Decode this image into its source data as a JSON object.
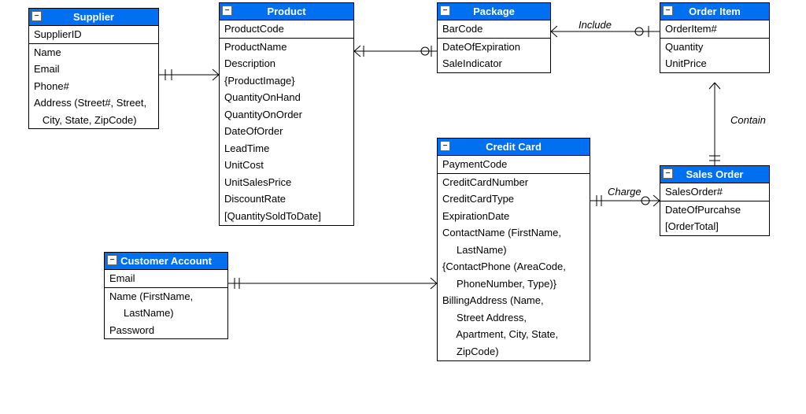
{
  "entities": {
    "supplier": {
      "title": "Supplier",
      "pk": [
        "SupplierID"
      ],
      "attrs": [
        "Name",
        "Email",
        "Phone#",
        "Address (Street#, Street,",
        "   City, State, ZipCode)"
      ]
    },
    "product": {
      "title": "Product",
      "pk": [
        "ProductCode"
      ],
      "attrs": [
        "ProductName",
        "Description",
        "{ProductImage}",
        "QuantityOnHand",
        "QuantityOnOrder",
        "DateOfOrder",
        "LeadTime",
        "UnitCost",
        "UnitSalesPrice",
        "DiscountRate",
        "[QuantitySoldToDate]"
      ]
    },
    "package": {
      "title": "Package",
      "pk": [
        "BarCode"
      ],
      "attrs": [
        "DateOfExpiration",
        "SaleIndicator"
      ]
    },
    "orderitem": {
      "title": "Order Item",
      "pk": [
        "OrderItem#"
      ],
      "attrs": [
        "Quantity",
        "UnitPrice"
      ]
    },
    "creditcard": {
      "title": "Credit Card",
      "pk": [
        "PaymentCode"
      ],
      "attrs": [
        "CreditCardNumber",
        "CreditCardType",
        "ExpirationDate",
        "ContactName (FirstName,",
        "     LastName)",
        "{ContactPhone (AreaCode,",
        "     PhoneNumber, Type)}",
        "BillingAddress (Name,",
        "     Street Address,",
        "     Apartment, City, State,",
        "     ZipCode)"
      ]
    },
    "salesorder": {
      "title": "Sales Order",
      "pk": [
        "SalesOrder#"
      ],
      "attrs": [
        "DateOfPurcahse",
        "[OrderTotal]"
      ]
    },
    "customer": {
      "title": "Customer Account",
      "pk": [
        "Email"
      ],
      "attrs": [
        "Name (FirstName,",
        "     LastName)",
        "Password"
      ]
    }
  },
  "relationships": {
    "include": "Include",
    "contain": "Contain",
    "charge": "Charge"
  },
  "colors": {
    "header": "#0070f0"
  }
}
